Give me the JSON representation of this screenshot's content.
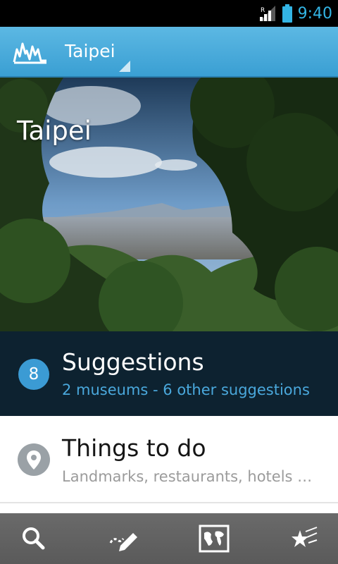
{
  "status_bar": {
    "time": "9:40",
    "roaming_indicator": "R"
  },
  "action_bar": {
    "city": "Taipei"
  },
  "hero": {
    "title": "Taipei"
  },
  "suggestions": {
    "count": "8",
    "title": "Suggestions",
    "subtitle": "2 museums - 6 other suggestions"
  },
  "things_to_do": {
    "title": "Things to do",
    "subtitle": "Landmarks, restaurants, hotels …"
  },
  "colors": {
    "accent": "#33b5e5",
    "action_bar": "#4aaee0",
    "card_dark": "#0d2230",
    "badge": "#3b9bd4"
  },
  "icons": [
    "signal-icon",
    "battery-icon",
    "app-logo-icon",
    "search-icon",
    "edit-icon",
    "map-icon",
    "favorites-icon",
    "location-pin-icon"
  ]
}
